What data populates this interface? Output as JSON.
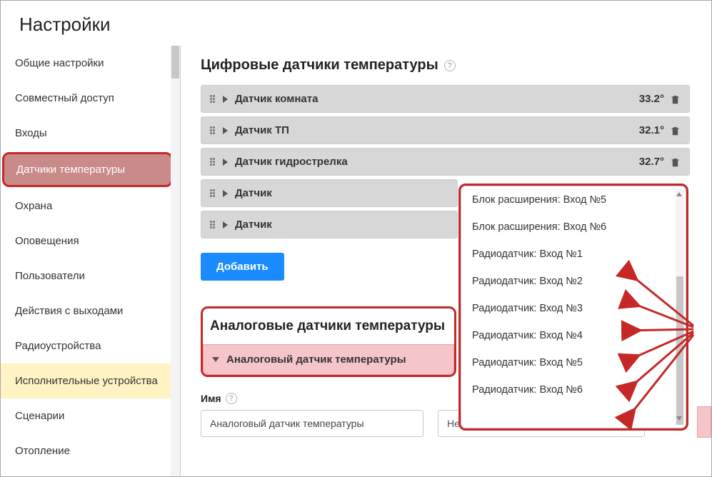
{
  "page_title": "Настройки",
  "sidebar": {
    "items": [
      {
        "label": "Общие настройки"
      },
      {
        "label": "Совместный доступ"
      },
      {
        "label": "Входы"
      },
      {
        "label": "Датчики температуры"
      },
      {
        "label": "Охрана"
      },
      {
        "label": "Оповещения"
      },
      {
        "label": "Пользователи"
      },
      {
        "label": "Действия с выходами"
      },
      {
        "label": "Радиоустройства"
      },
      {
        "label": "Исполнительные устройства"
      },
      {
        "label": "Сценарии"
      },
      {
        "label": "Отопление"
      }
    ]
  },
  "digital": {
    "title": "Цифровые датчики температуры",
    "sensors": [
      {
        "name": "Датчик комната",
        "temp": "33.2°"
      },
      {
        "name": "Датчик ТП",
        "temp": "32.1°"
      },
      {
        "name": "Датчик гидрострелка",
        "temp": "32.7°"
      },
      {
        "name": "Датчик",
        "temp": ""
      },
      {
        "name": "Датчик",
        "temp": ""
      }
    ],
    "add_label": "Добавить"
  },
  "analog": {
    "title": "Аналоговые датчики температуры",
    "row_label": "Аналоговый датчик температуры",
    "field_label": "Имя",
    "name_value": "Аналоговый датчик температуры",
    "select_value": "Не выбрано"
  },
  "dropdown": {
    "options": [
      "Блок расширения: Вход №5",
      "Блок расширения: Вход №6",
      "Радиодатчик: Вход №1",
      "Радиодатчик: Вход №2",
      "Радиодатчик: Вход №3",
      "Радиодатчик: Вход №4",
      "Радиодатчик: Вход №5",
      "Радиодатчик: Вход №6"
    ]
  }
}
